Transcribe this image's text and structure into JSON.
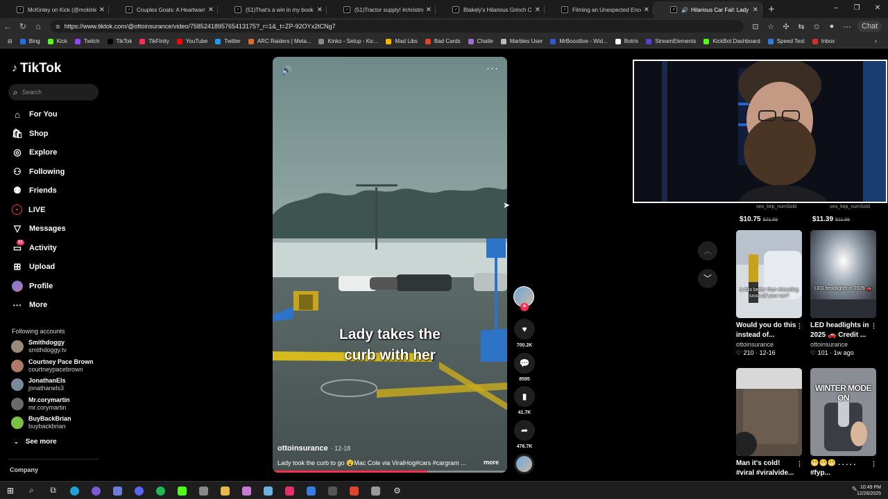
{
  "browser": {
    "tabs": [
      {
        "title": "McKinley on Kick (@mckinley.tv) | ",
        "icon": "tiktok-icon",
        "active": false
      },
      {
        "title": "Couples Goals: A Heartwarming Tr",
        "icon": "tiktok-icon",
        "active": false
      },
      {
        "title": "(51)That's a win in my book | TikTo",
        "icon": "tiktok-icon",
        "active": false
      },
      {
        "title": "(51)Tractor supply! #christmas | tra",
        "icon": "tiktok-icon",
        "active": false
      },
      {
        "title": "Blakely's Hilarious Grinch Christma",
        "icon": "tiktok-icon",
        "active": false
      },
      {
        "title": "Filming an Unexpected Encounter",
        "icon": "tiktok-icon",
        "active": false
      },
      {
        "title": "Hilarious Car Fail: Lady Hits th",
        "icon": "tiktok-icon",
        "active": true,
        "audio": true
      }
    ],
    "new_tab": "+",
    "window_controls": [
      "–",
      "❐",
      "✕"
    ],
    "url": "https://www.tiktok.com/@ottoinsurance/video/7585241895765413175?_r=1&_t=ZP-92OYx2tCNg7",
    "chat_label": "Chat",
    "bookmarks": [
      {
        "label": "Bing",
        "color": "#1a73e8"
      },
      {
        "label": "Kick",
        "color": "#53fc18"
      },
      {
        "label": "Twitch",
        "color": "#9146ff"
      },
      {
        "label": "TikTok",
        "color": "#000000"
      },
      {
        "label": "TikFinity",
        "color": "#fe2c55"
      },
      {
        "label": "YouTube",
        "color": "#ff0000"
      },
      {
        "label": "Twitter",
        "color": "#1d9bf0"
      },
      {
        "label": "ARC Raiders | Meta...",
        "color": "#d96c2c"
      },
      {
        "label": "Kinko - Setup - Kic...",
        "color": "#888888"
      },
      {
        "label": "Mad Libs",
        "color": "#f5b400"
      },
      {
        "label": "Bad Cards",
        "color": "#e0452a"
      },
      {
        "label": "Chatle",
        "color": "#a06cd5"
      },
      {
        "label": "Marbles User",
        "color": "#bbbbbb"
      },
      {
        "label": "MrBoostlive - Wid...",
        "color": "#2e5bd8"
      },
      {
        "label": "Botrix",
        "color": "#ffffff"
      },
      {
        "label": "StreamElements",
        "color": "#5a3fd8"
      },
      {
        "label": "KickBot Dashboard",
        "color": "#53fc18"
      },
      {
        "label": "Speed Test",
        "color": "#2e7de0"
      },
      {
        "label": "Inbox",
        "color": "#d93025"
      }
    ]
  },
  "sidebar": {
    "logo": "TikTok",
    "search_placeholder": "Search",
    "nav": [
      {
        "label": "For You",
        "icon": "home-icon",
        "glyph": "⌂"
      },
      {
        "label": "Shop",
        "icon": "shopping-bag-icon",
        "glyph": "🛍"
      },
      {
        "label": "Explore",
        "icon": "compass-icon",
        "glyph": "◎"
      },
      {
        "label": "Following",
        "icon": "user-follow-icon",
        "glyph": "⚇"
      },
      {
        "label": "Friends",
        "icon": "friends-icon",
        "glyph": "⚉"
      },
      {
        "label": "LIVE",
        "icon": "live-icon",
        "glyph": "LIVE"
      },
      {
        "label": "Messages",
        "icon": "paper-plane-icon",
        "glyph": "▽"
      },
      {
        "label": "Activity",
        "icon": "inbox-icon",
        "glyph": "▭",
        "badge": "51"
      },
      {
        "label": "Upload",
        "icon": "plus-square-icon",
        "glyph": "⊞"
      },
      {
        "label": "Profile",
        "icon": "profile-avatar-icon",
        "glyph": ""
      },
      {
        "label": "More",
        "icon": "more-dots-icon",
        "glyph": "···"
      }
    ],
    "following_title": "Following accounts",
    "following": [
      {
        "name": "Smithdoggy",
        "handle": "smithdoggy.tv",
        "color": "#9a8a7a"
      },
      {
        "name": "Courtney Pace Brown",
        "handle": "courtneypacebrown",
        "color": "#b07a6a"
      },
      {
        "name": "JonathanEls",
        "handle": "jonathanels3",
        "color": "#7a8a9a"
      },
      {
        "name": "Mr.corymartin",
        "handle": "mr.corymartin",
        "color": "#6a6a6a"
      },
      {
        "name": "BuyBackBrian",
        "handle": "buybackbrian",
        "color": "#7cc242"
      }
    ],
    "see_more": "See more",
    "company": "Company"
  },
  "video": {
    "caption": [
      "Lady takes the",
      "curb with her"
    ],
    "author": "ottoinsurance",
    "date": "· 12-18",
    "description": "Lady took the curb to go 😮Mac Cole via ViralHog#cars #cargram ...",
    "more": "more",
    "progress": 0.66
  },
  "actions": [
    {
      "name": "like-button",
      "icon": "heart-icon",
      "glyph": "♥",
      "count": "700.2K"
    },
    {
      "name": "comment-button",
      "icon": "comment-icon",
      "glyph": "💬",
      "count": "8595"
    },
    {
      "name": "bookmark-button",
      "icon": "bookmark-icon",
      "glyph": "▮",
      "count": "41.7K"
    },
    {
      "name": "share-button",
      "icon": "share-arrow-icon",
      "glyph": "➦",
      "count": "476.7K"
    }
  ],
  "shop": {
    "items": [
      {
        "sku": "seo_kep_numSold",
        "price": "$10.75",
        "old_price": "$21.59"
      },
      {
        "sku": "seo_kep_numSold",
        "price": "$11.39",
        "old_price": "$11.99"
      }
    ]
  },
  "related": [
    {
      "title": "Would you do this instead of...",
      "author": "ottoinsurance",
      "stats": "♡ 210 · 12-16",
      "overlay": "is this better than shoveling snow off your car?"
    },
    {
      "title": "LED headlights in 2025 🚗 Credit ...",
      "author": "ottoinsurance",
      "stats": "♡ 101 · 1w ago",
      "overlay": "LED headlights in 2025 🚗"
    },
    {
      "title": "Man it's cold! #viral #viralvide...",
      "author": "",
      "stats": "",
      "overlay": ""
    },
    {
      "title": "😬😬😬 . . . . . #fyp...",
      "author": "",
      "stats": "",
      "overlay": "WINTER MODE ON"
    }
  ],
  "taskbar": {
    "icons": [
      {
        "name": "windows-start-icon",
        "glyph": "⊞",
        "color": "#ffffff"
      },
      {
        "name": "search-icon",
        "glyph": "⌕",
        "color": ""
      },
      {
        "name": "task-view-icon",
        "glyph": "⧉",
        "color": ""
      },
      {
        "name": "edge-browser-icon",
        "glyph": "",
        "color": "#1fa0d8"
      },
      {
        "name": "chrome-icon",
        "glyph": "",
        "color": "#7b5cd6"
      },
      {
        "name": "app-icon",
        "glyph": "",
        "color": "#6b7dd8"
      },
      {
        "name": "discord-icon",
        "glyph": "",
        "color": "#5865f2"
      },
      {
        "name": "spotify-icon",
        "glyph": "",
        "color": "#1db954"
      },
      {
        "name": "app-icon",
        "glyph": "",
        "color": "#53fc18"
      },
      {
        "name": "app-icon",
        "glyph": "",
        "color": "#888888"
      },
      {
        "name": "folder-icon",
        "glyph": "",
        "color": "#e8b84a"
      },
      {
        "name": "app-icon",
        "glyph": "",
        "color": "#c97ad6"
      },
      {
        "name": "app-icon",
        "glyph": "",
        "color": "#6ab0e0"
      },
      {
        "name": "instagram-icon",
        "glyph": "",
        "color": "#e1306c"
      },
      {
        "name": "app-icon",
        "glyph": "",
        "color": "#3a7be0"
      },
      {
        "name": "app-icon",
        "glyph": "",
        "color": "#555555"
      },
      {
        "name": "app-icon",
        "glyph": "",
        "color": "#e0452a"
      },
      {
        "name": "app-icon",
        "glyph": "",
        "color": "#9a9a9a"
      },
      {
        "name": "settings-gear-icon",
        "glyph": "⚙",
        "color": ""
      }
    ],
    "time": "10:49 PM",
    "date": "12/26/2025"
  }
}
